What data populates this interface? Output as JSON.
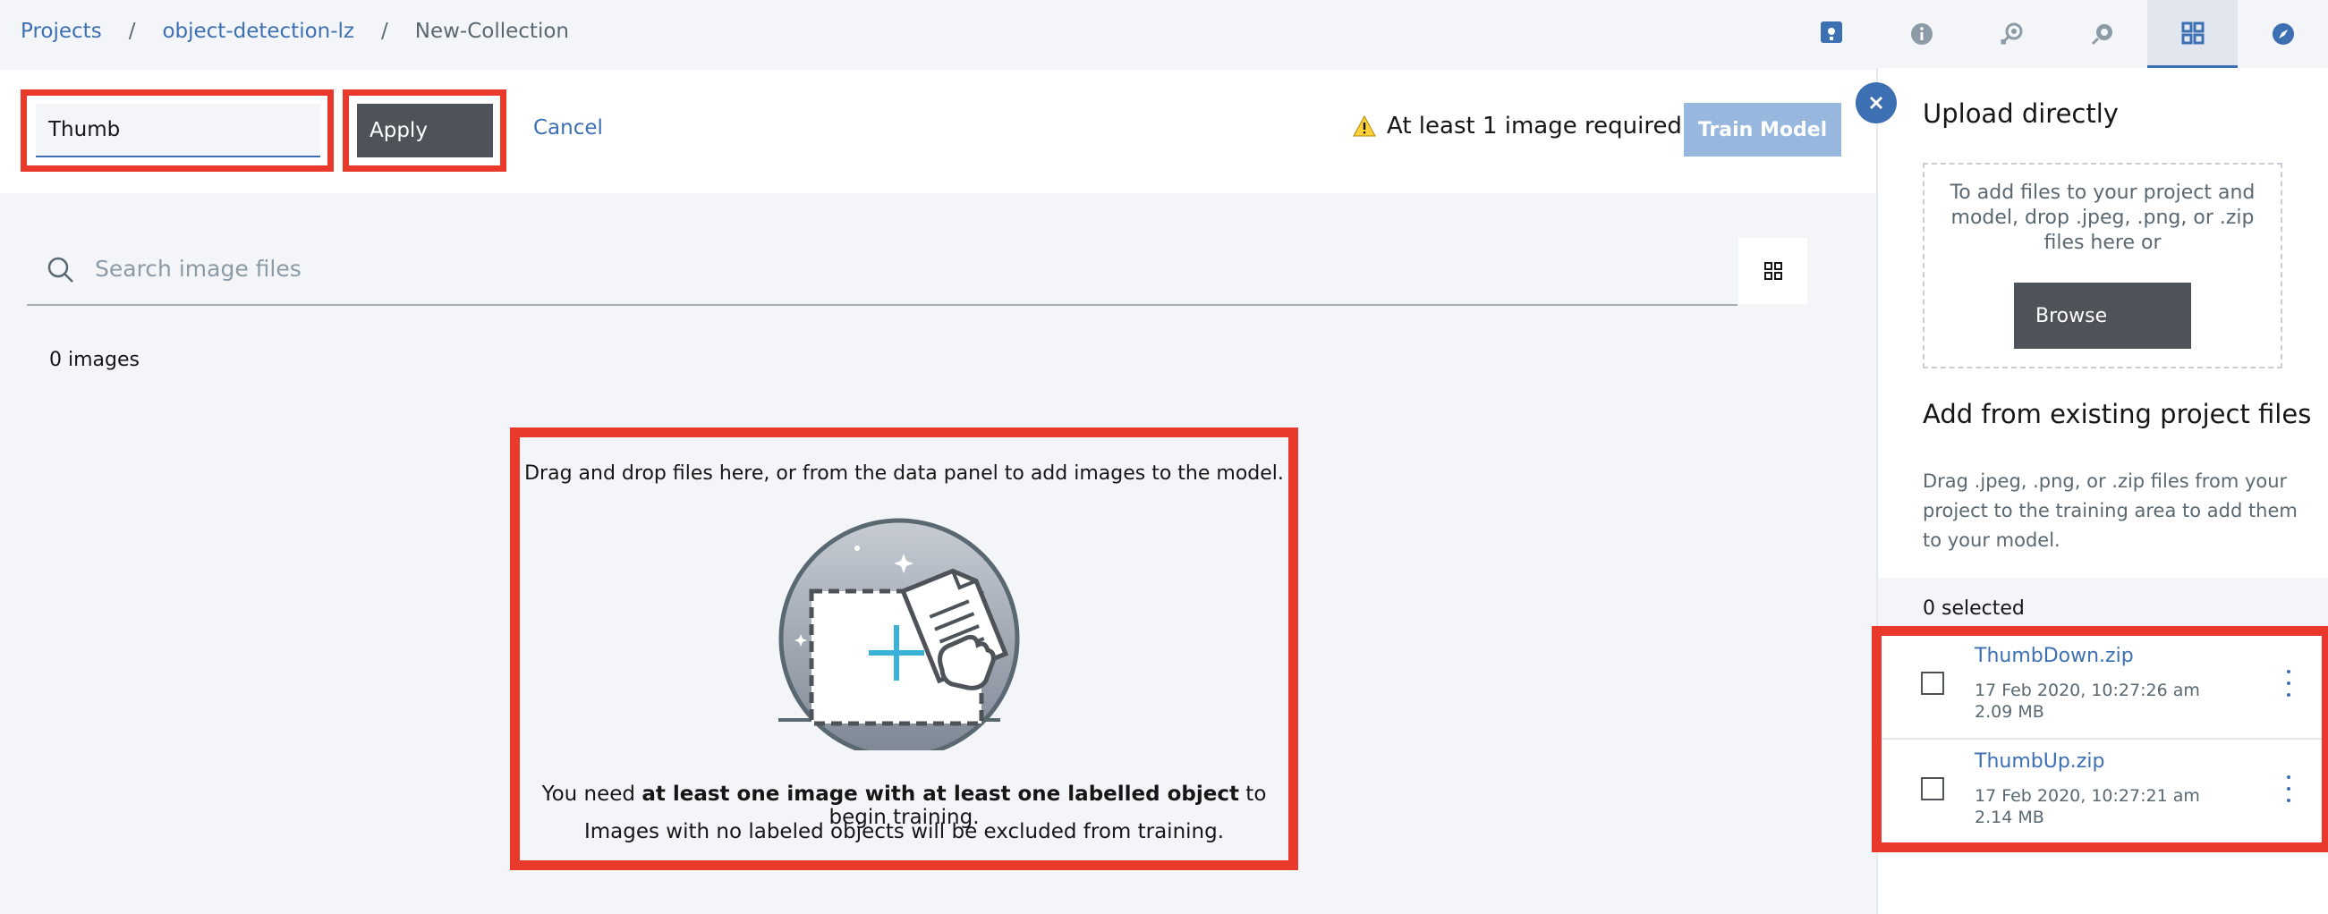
{
  "breadcrumb": {
    "items": [
      "Projects",
      "object-detection-lz",
      "New-Collection"
    ],
    "separator": "/"
  },
  "toolbar": {
    "name_value": "Thumb",
    "apply_label": "Apply",
    "cancel_label": "Cancel",
    "requirement_text": "At least 1 image required",
    "train_label": "Train Model"
  },
  "search": {
    "placeholder": "Search image files"
  },
  "images": {
    "count_text": "0 images"
  },
  "dropzone": {
    "instruction": "Drag and drop files here, or from the data panel to add images to the model.",
    "need_prefix": "You need ",
    "need_bold": "at least one image with at least one labelled object",
    "need_suffix": " to begin training.",
    "exclusion_note": "Images with no labeled objects will be excluded from training."
  },
  "panel": {
    "upload_heading": "Upload directly",
    "upload_text": "To add files to your project and model, drop .jpeg, .png, or .zip files here or",
    "browse_label": "Browse",
    "existing_heading": "Add from existing project files",
    "existing_desc": "Drag .jpeg, .png, or .zip files from your project to the training area to add them to your model.",
    "selected_text": "0 selected",
    "files": [
      {
        "name": "ThumbDown.zip",
        "date": "17 Feb 2020, 10:27:26 am",
        "size": "2.09 MB"
      },
      {
        "name": "ThumbUp.zip",
        "date": "17 Feb 2020, 10:27:21 am",
        "size": "2.14 MB"
      }
    ]
  },
  "rail": {
    "icons": [
      "info-icon",
      "model-icon",
      "deploy-icon",
      "data-icon",
      "compass-icon"
    ],
    "active": "data-icon"
  },
  "colors": {
    "accent": "#3d70b2",
    "highlight": "#e8392a",
    "warning": "#fdd13a",
    "button_dark": "#4d5358",
    "train_disabled": "#97b7df"
  }
}
